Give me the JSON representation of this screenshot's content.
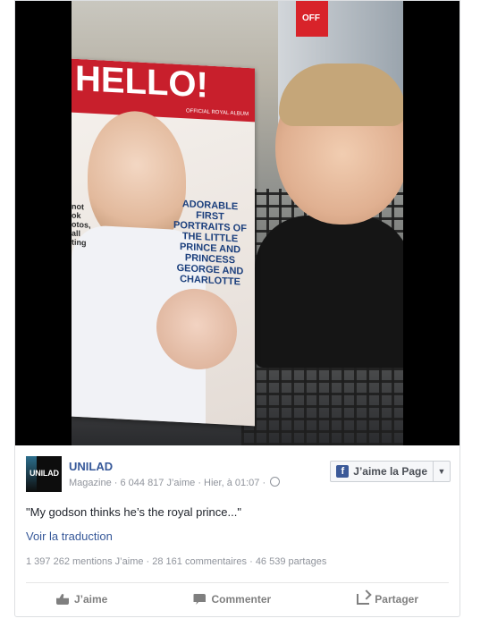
{
  "post": {
    "photo": {
      "magazine_masthead": "HELLO!",
      "magazine_tag": "OFFICIAL ROYAL ALBUM",
      "magazine_headline": "ADORABLE FIRST PORTRAITS OF THE LITTLE PRINCE AND PRINCESS GEORGE AND CHARLOTTE",
      "magazine_side_text": "not\nok\notos,\nall\nting",
      "store_sign": "OFF"
    },
    "page": {
      "avatar_text": "UNILAD",
      "name": "UNILAD",
      "category": "Magazine",
      "likes": "6 044 817 J’aime",
      "time": "Hier, à 01:07",
      "like_page_button": "J’aime la Page",
      "dropdown_caret": "▼"
    },
    "message": "\"My godson thinks he’s the royal prince...\"",
    "translate_link": "Voir la traduction",
    "counts": {
      "reactions": "1 397 262 mentions J’aime",
      "comments": "28 161 commentaires",
      "shares": "46 539 partages"
    },
    "actions": {
      "like": "J’aime",
      "comment": "Commenter",
      "share": "Partager"
    }
  },
  "colors": {
    "link_blue": "#365899",
    "meta_grey": "#90949c",
    "facebook_blue": "#3b5998"
  }
}
